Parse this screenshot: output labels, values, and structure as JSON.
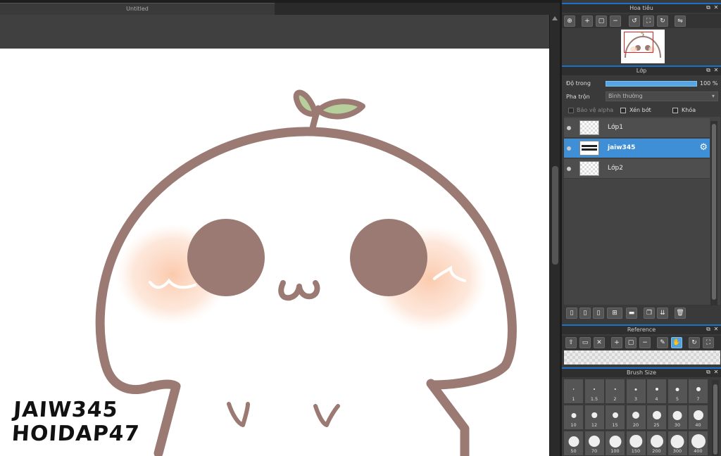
{
  "document": {
    "tab_title": "Untitled",
    "watermark_line1": "JAIW345",
    "watermark_line2": "HOIDAP47"
  },
  "navigator": {
    "title": "Hoa tiêu",
    "tools": [
      "zoom-fit-icon",
      "zoom-in-icon",
      "fit-window-icon",
      "zoom-out-icon",
      "rotate-left-icon",
      "actual-size-icon",
      "rotate-right-icon",
      "flip-horizontal-icon"
    ]
  },
  "layers": {
    "title": "Lớp",
    "opacity_label": "Độ trong",
    "opacity_value": "100 %",
    "opacity": 1.0,
    "blend_label": "Pha trộn",
    "blend_value": "Bình thường",
    "protect_alpha_label": "Bảo vệ alpha",
    "clipping_label": "Xén bớt",
    "lock_label": "Khóa",
    "items": [
      {
        "name": "Lớp1",
        "selected": false
      },
      {
        "name": "jaiw345",
        "selected": true
      },
      {
        "name": "Lớp2",
        "selected": false
      }
    ]
  },
  "reference": {
    "title": "Reference"
  },
  "brush_size": {
    "title": "Brush Size",
    "sizes": [
      "1",
      "1.5",
      "2",
      "3",
      "4",
      "5",
      "7",
      "10",
      "12",
      "15",
      "20",
      "25",
      "30",
      "40",
      "50",
      "70",
      "100",
      "150",
      "200",
      "300",
      "400"
    ]
  },
  "colors": {
    "accent": "#3f8fd6",
    "panel": "#3a3a3a",
    "drawing_brown": "#9c7a74",
    "leaf_green": "#b6cf9b",
    "blush": "#fbd0b6"
  }
}
